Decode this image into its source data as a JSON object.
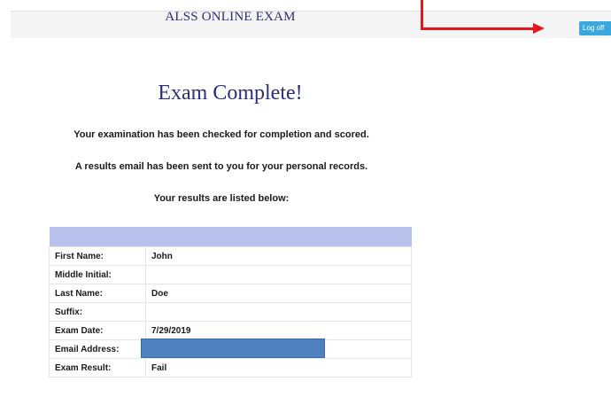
{
  "header": {
    "title": "ALSS ONLINE EXAM",
    "logoff_label": "Log off"
  },
  "main": {
    "heading": "Exam Complete!",
    "messages": [
      "Your examination has been checked for completion and scored.",
      "A results email has been sent to you for your personal records.",
      "Your results are listed below:"
    ],
    "results": {
      "rows": [
        {
          "label": "First Name:",
          "value": "John"
        },
        {
          "label": "Middle Initial:",
          "value": ""
        },
        {
          "label": "Last Name:",
          "value": "Doe"
        },
        {
          "label": "Suffix:",
          "value": ""
        },
        {
          "label": "Exam Date:",
          "value": "7/29/2019"
        },
        {
          "label": "Email Address:",
          "value": ""
        },
        {
          "label": "Exam Result:",
          "value": "Fail"
        }
      ]
    }
  },
  "colors": {
    "title_blue": "#2b2e7a",
    "button_blue": "#3aa8dc",
    "table_header": "#b8c2ec",
    "annotation_red": "#e8151b",
    "redaction_blue": "#4f80bf"
  }
}
